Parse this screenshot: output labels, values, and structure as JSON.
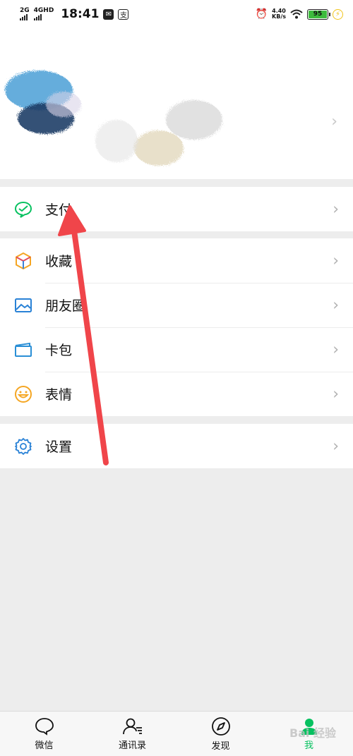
{
  "status_bar": {
    "net1": "2G",
    "net2": "4GHD",
    "time": "18:41",
    "speed_value": "4.40",
    "speed_unit": "KB/s",
    "battery": "95"
  },
  "menu": {
    "pay": "支付",
    "favorites": "收藏",
    "moments": "朋友圈",
    "cards": "卡包",
    "stickers": "表情",
    "settings": "设置"
  },
  "tabs": [
    {
      "label": "微信",
      "icon": "chat-bubble-icon"
    },
    {
      "label": "通讯录",
      "icon": "contacts-icon"
    },
    {
      "label": "发现",
      "icon": "compass-icon"
    },
    {
      "label": "我",
      "icon": "me-icon",
      "active": true
    }
  ],
  "watermark": "Bai 经验",
  "colors": {
    "accent_green": "#07c160",
    "arrow_red": "#f0454a",
    "background": "#ededed"
  }
}
